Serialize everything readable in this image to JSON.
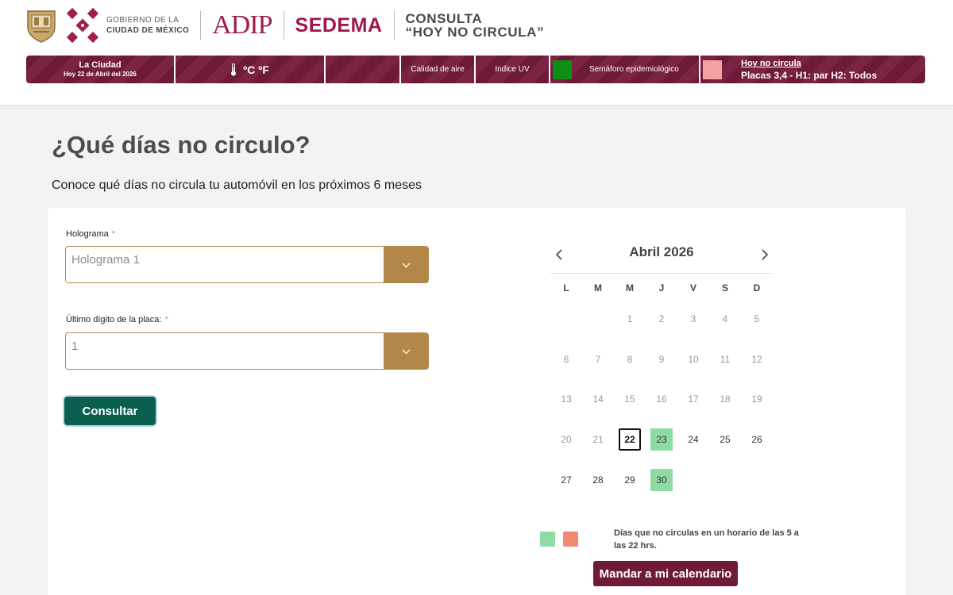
{
  "header": {
    "gobierno_line1": "GOBIERNO DE LA",
    "gobierno_line2": "CIUDAD DE MÉXICO",
    "adip_logo": "ADIP",
    "sedema_logo": "SEDEMA",
    "consulta_line1": "CONSULTA",
    "consulta_line2": "“HOY NO CIRCULA”"
  },
  "infobar": {
    "city_title": "La Ciudad",
    "city_date": "Hoy 22 de Abril del 2026",
    "temperature_units": "ºC ºF",
    "air_quality": "Calidad de aire",
    "uv_index": "Indice UV",
    "semaforo": "Semáforo epidemiológico",
    "hnc_link": "Hoy no circula",
    "hnc_detail": "Placas 3,4 - H1: par H2: Todos",
    "colors": {
      "bar": "#6d1a37",
      "semaforo": "#0a8f14",
      "hnc": "#f4a3a3"
    }
  },
  "main": {
    "title": "¿Qué días no circulo?",
    "subtitle": "Conoce qué días no circula tu automóvil en los próximos 6 meses"
  },
  "form": {
    "hologram_label": "Holograma",
    "hologram_value": "Holograma 1",
    "digit_label": "Último dígito de la placa:",
    "digit_value": "1",
    "required_mark": "*",
    "submit_label": "Consultar"
  },
  "calendar": {
    "month_label": "Abril 2026",
    "weekdays": [
      "L",
      "M",
      "M",
      "J",
      "V",
      "S",
      "D"
    ],
    "weeks": [
      [
        "",
        "",
        "1",
        "2",
        "3",
        "4",
        "5"
      ],
      [
        "6",
        "7",
        "8",
        "9",
        "10",
        "11",
        "12"
      ],
      [
        "13",
        "14",
        "15",
        "16",
        "17",
        "18",
        "19"
      ],
      [
        "20",
        "21",
        "22",
        "23",
        "24",
        "25",
        "26"
      ],
      [
        "27",
        "28",
        "29",
        "30",
        "",
        "",
        ""
      ]
    ],
    "today": "22",
    "no_circula_days": [
      "23",
      "30"
    ],
    "colors": {
      "no_circula": "#8fdba4",
      "legend_red": "#f08a72"
    }
  },
  "legend": {
    "text": "Días que no circulas en un horario de las 5 a las 22 hrs."
  },
  "actions": {
    "send_calendar_label": "Mandar a mi calendario"
  }
}
